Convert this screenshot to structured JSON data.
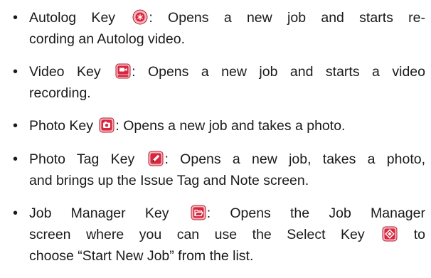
{
  "bullet_symbol": "•",
  "items": [
    {
      "key_icon": "autolog-key-icon",
      "line1_before": "Autolog Key ",
      "line1_after": ": Opens a new job and starts re-",
      "line2": "cording an Autolog video."
    },
    {
      "key_icon": "video-key-icon",
      "line1_before": "Video Key ",
      "line1_after": ": Opens a new job and starts a video",
      "line2": "recording."
    },
    {
      "key_icon": "photo-key-icon",
      "line1_before": "Photo Key ",
      "line1_after": ": Opens a new job and takes a photo."
    },
    {
      "key_icon": "photo-tag-key-icon",
      "line1_before": "Photo Tag Key ",
      "line1_after": ": Opens a new job, takes a photo,",
      "line2": "and brings up the Issue Tag and Note screen."
    },
    {
      "key_icon": "job-manager-key-icon",
      "line1_before": "Job Manager Key ",
      "line1_after": ": Opens the Job Manager",
      "line2_before": "screen where you can use the Select Key ",
      "line2_icon": "select-key-icon",
      "line2_after": " to",
      "line3": "choose “Start New Job” from the list."
    }
  ],
  "colors": {
    "icon_red": "#d7263d",
    "icon_red_light": "#f4b5bd",
    "icon_border": "#b01e30",
    "text": "#1a1a1a"
  }
}
